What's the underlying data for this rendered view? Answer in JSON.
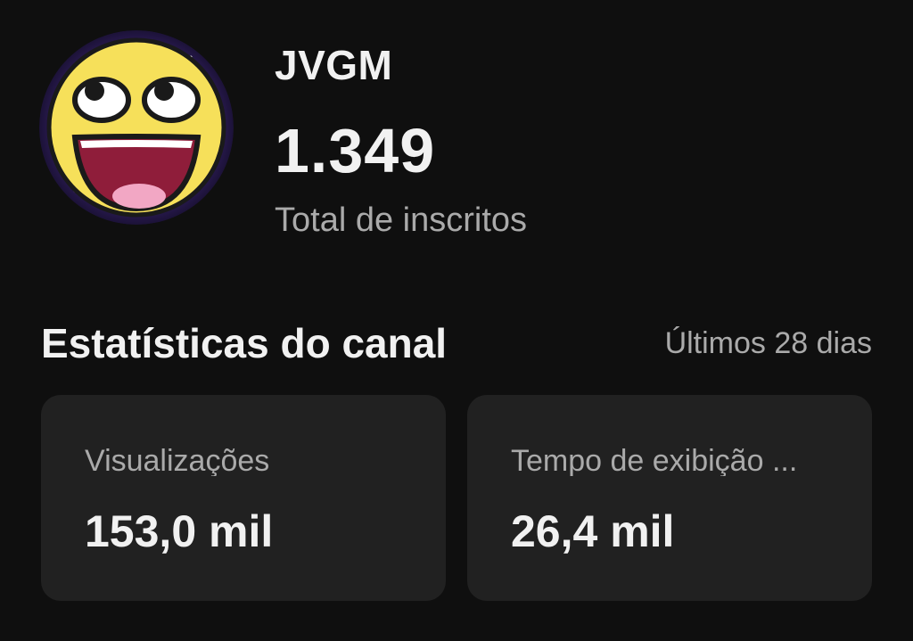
{
  "channel": {
    "name": "JVGM",
    "subscribers": "1.349",
    "subscribers_label": "Total de inscritos",
    "avatar_icon": "smiley-face-icon"
  },
  "stats": {
    "title": "Estatísticas do canal",
    "period": "Últimos 28 dias",
    "cards": [
      {
        "label": "Visualizações",
        "value": "153,0 mil"
      },
      {
        "label": "Tempo de exibição ...",
        "value": "26,4 mil"
      }
    ]
  },
  "colors": {
    "background": "#0f0f0f",
    "card": "#212121",
    "primary_text": "#f1f1f1",
    "secondary_text": "#aaaaaa"
  }
}
